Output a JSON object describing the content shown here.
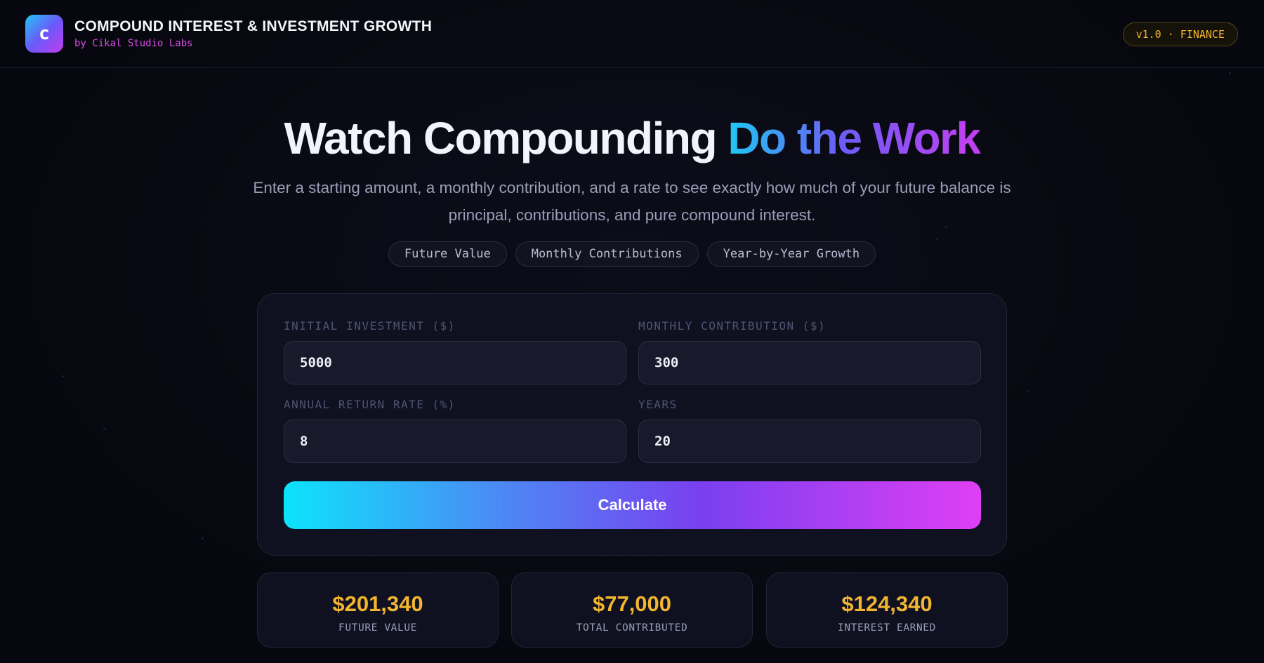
{
  "header": {
    "logo_letter": "c",
    "title": "COMPOUND INTEREST & INVESTMENT GROWTH",
    "subtitle": "by Cikal Studio Labs",
    "version_badge": "v1.0 · FINANCE"
  },
  "hero": {
    "title_plain": "Watch Compounding ",
    "title_highlight": "Do the Work",
    "description": "Enter a starting amount, a monthly contribution, and a rate to see exactly how much of your future balance is principal, contributions, and pure compound interest.",
    "chips": [
      "Future Value",
      "Monthly Contributions",
      "Year-by-Year Growth"
    ]
  },
  "form": {
    "fields": [
      {
        "label": "INITIAL INVESTMENT ($)",
        "value": "5000"
      },
      {
        "label": "MONTHLY CONTRIBUTION ($)",
        "value": "300"
      },
      {
        "label": "ANNUAL RETURN RATE (%)",
        "value": "8"
      },
      {
        "label": "YEARS",
        "value": "20"
      }
    ],
    "calculate_label": "Calculate"
  },
  "results": [
    {
      "value": "$201,340",
      "label": "FUTURE VALUE"
    },
    {
      "value": "$77,000",
      "label": "TOTAL CONTRIBUTED"
    },
    {
      "value": "$124,340",
      "label": "INTEREST EARNED"
    }
  ],
  "colors": {
    "background": "#07080f",
    "card": "#0f1020",
    "accent_gold": "#f2b530",
    "gradient_start": "#0de3fb",
    "gradient_end": "#df3ff4",
    "subtitle_magenta": "#d94ee6"
  }
}
